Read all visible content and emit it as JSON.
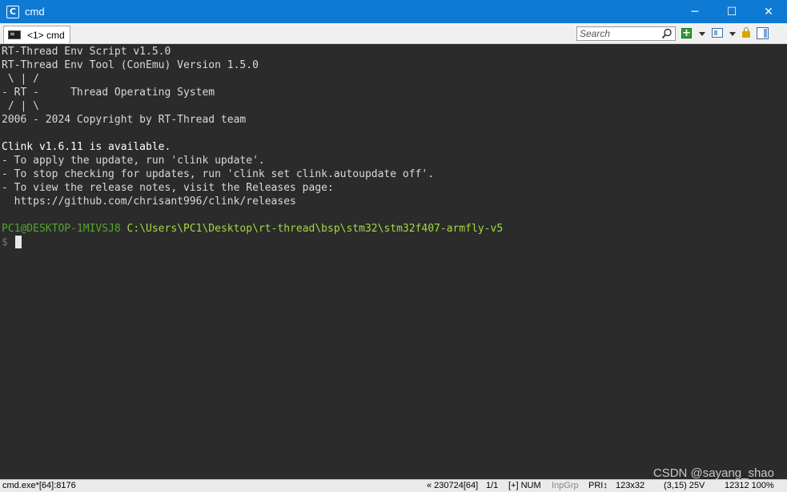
{
  "window": {
    "title": "cmd",
    "icon": "conemu-icon",
    "controls": {
      "minimize": "─",
      "maximize": "☐",
      "close": "✕"
    }
  },
  "tabs": [
    {
      "label": "<1> cmd",
      "icon": "console-icon",
      "active": true
    }
  ],
  "toolbar": {
    "search_placeholder": "Search",
    "icons": [
      "search-icon",
      "new-console-plus-icon",
      "chevron-down-icon",
      "split-view-icon",
      "chevron-down-icon",
      "lock-icon",
      "panel-icon",
      "menu-icon"
    ]
  },
  "console": {
    "lines": [
      "RT-Thread Env Script v1.5.0",
      "RT-Thread Env Tool (ConEmu) Version 1.5.0",
      " \\ | /",
      "- RT -     Thread Operating System",
      " / | \\",
      "2006 - 2024 Copyright by RT-Thread team",
      "",
      "Clink v1.6.11 is available.",
      "- To apply the update, run 'clink update'.",
      "- To stop checking for updates, run 'clink set clink.autoupdate off'.",
      "- To view the release notes, visit the Releases page:",
      "  https://github.com/chrisant996/clink/releases",
      ""
    ],
    "prompt_host": "PC1@DESKTOP-1MIVSJ8",
    "prompt_path": "C:\\Users\\PC1\\Desktop\\rt-thread\\bsp\\stm32\\stm32f407-armfly-v5",
    "prompt_symbol": "$",
    "colors": {
      "background": "#2b2b2b",
      "text": "#d9d9d9",
      "host": "#56a630",
      "path": "#9fdc3f"
    }
  },
  "watermark": "CSDN @sayang_shao",
  "statusbar": {
    "process": "cmd.exe*[64]:8176",
    "build": "« 230724[64]",
    "console_index": "1/1",
    "modifiers": "[+] NUM",
    "input_group": "InpGrp",
    "priority": "PRI↕",
    "size": "123x32",
    "cursor": "(3,15) 25V",
    "pid_zoom": "12312 100%"
  }
}
